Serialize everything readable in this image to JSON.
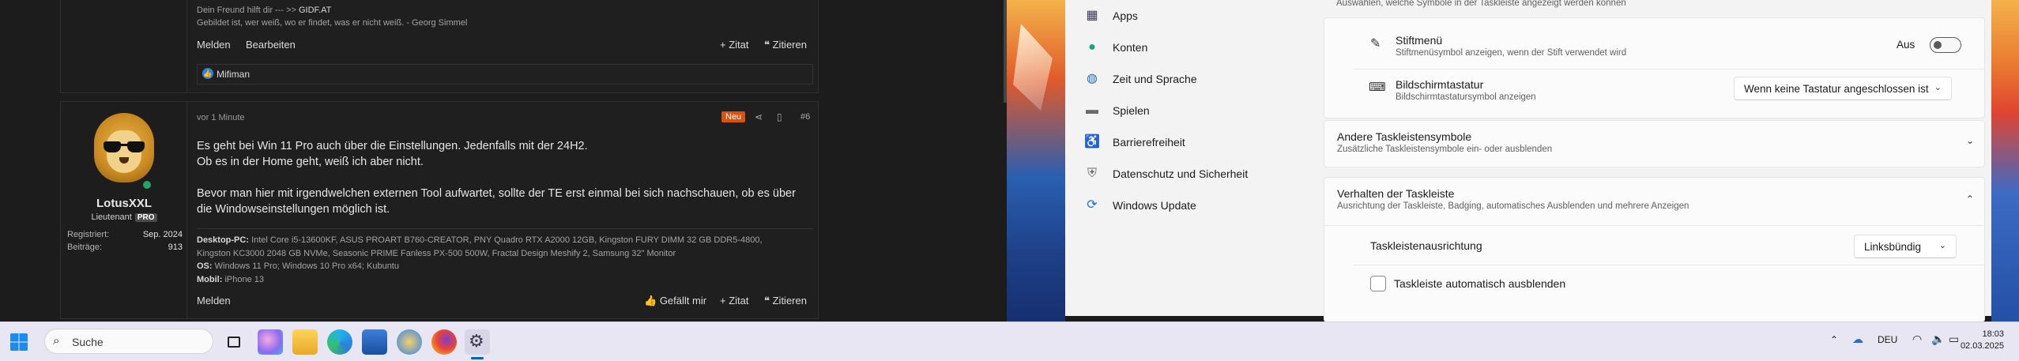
{
  "forum": {
    "top_post": {
      "sig_line1_prefix": "Dein Freund hilft dir --- >>",
      "sig_link": "GIDF.AT",
      "sig_line2": "Gebildet ist, wer weiß, wo er findet, was er nicht weiß. - Georg Simmel",
      "report": "Melden",
      "edit": "Bearbeiten",
      "quote": "+ Zitat",
      "cite": "Zitieren",
      "liker": "Mifiman"
    },
    "post": {
      "author": "LotusXXL",
      "rank": "Lieutenant",
      "rank_badge": "PRO",
      "registered_label": "Registriert:",
      "registered_value": "Sep. 2024",
      "posts_label": "Beiträge:",
      "posts_value": "913",
      "time": "vor 1 Minute",
      "new_badge": "Neu",
      "number": "#6",
      "body": [
        "Es geht bei Win 11 Pro auch über die Einstellungen. Jedenfalls mit der 24H2.",
        "Ob es in der Home geht, weiß ich aber nicht.",
        "",
        "Bevor man hier mit irgendwelchen externen Tool aufwartet, sollte der TE erst einmal bei sich nachschauen, ob es über",
        "die Windowseinstellungen möglich ist."
      ],
      "sig": {
        "desktop_label": "Desktop-PC:",
        "desktop_1": "Intel Core i5-13600KF, ASUS PROART B760-CREATOR, PNY Quadro RTX A2000 12GB, Kingston FURY DIMM 32 GB DDR5-4800,",
        "desktop_2": "Kingston KC3000 2048 GB NVMe, Seasonic PRIME Fanless PX-500 500W, Fractal Design Meshify 2, Samsung 32\" Monitor",
        "os_label": "OS:",
        "os": "Windows 11 Pro; Windows 10 Pro x64; Kubuntu",
        "mobil_label": "Mobil:",
        "mobil": "iPhone 13"
      },
      "report": "Melden",
      "like": "Gefällt mir",
      "quote": "+ Zitat",
      "cite": "Zitieren"
    }
  },
  "settings": {
    "nav": [
      {
        "label": "Apps",
        "icon": "apps-icon"
      },
      {
        "label": "Konten",
        "icon": "account-icon"
      },
      {
        "label": "Zeit und Sprache",
        "icon": "globe-clock-icon"
      },
      {
        "label": "Spielen",
        "icon": "gamepad-icon"
      },
      {
        "label": "Barrierefreiheit",
        "icon": "accessibility-icon"
      },
      {
        "label": "Datenschutz und Sicherheit",
        "icon": "shield-icon"
      },
      {
        "label": "Windows Update",
        "icon": "update-icon"
      }
    ],
    "top_hint": "Auswählen, welche Symbole in der Taskleiste angezeigt werden können",
    "pen_menu": {
      "title": "Stiftmenü",
      "subtitle": "Stiftmenüsymbol anzeigen, wenn der Stift verwendet wird",
      "state": "Aus"
    },
    "touch_keyboard": {
      "title": "Bildschirmtastatur",
      "subtitle": "Bildschirmtastatursymbol anzeigen",
      "value": "Wenn keine Tastatur angeschlossen ist"
    },
    "other_icons": {
      "title": "Andere Taskleistensymbole",
      "subtitle": "Zusätzliche Taskleistensymbole ein- oder ausblenden"
    },
    "behavior": {
      "title": "Verhalten der Taskleiste",
      "subtitle": "Ausrichtung der Taskleiste, Badging, automatisches Ausblenden und mehrere Anzeigen"
    },
    "alignment": {
      "title": "Taskleistenausrichtung",
      "value": "Linksbündig"
    },
    "autohide": {
      "title": "Taskleiste automatisch ausblenden"
    }
  },
  "taskbar": {
    "search_placeholder": "Suche",
    "language": "DEU",
    "time": "18:03",
    "date": "02.03.2025"
  }
}
